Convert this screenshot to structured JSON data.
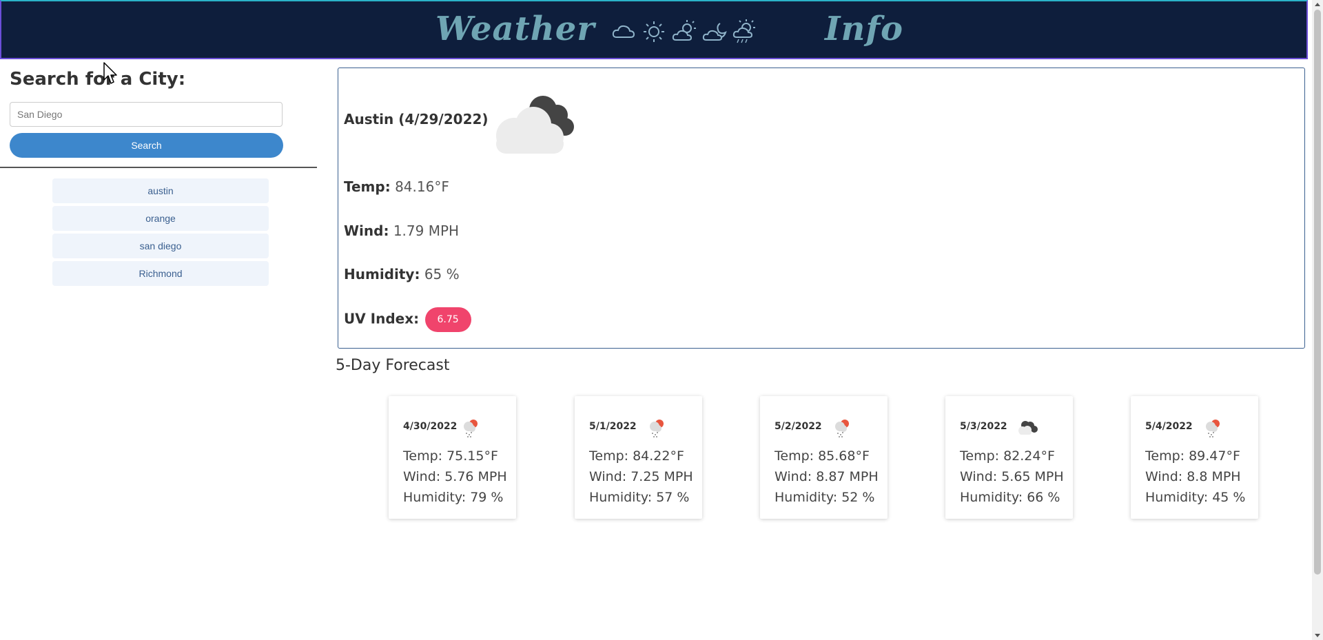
{
  "header": {
    "brand_left": "Weather",
    "brand_right": "Info",
    "icons": [
      "cloud-icon",
      "sun-icon",
      "partly-sunny-icon",
      "cloudy-night-icon",
      "sun-rain-icon"
    ],
    "brand_color": "#6fa5b3",
    "background": "#0e1e3c"
  },
  "search": {
    "title": "Search for a City:",
    "placeholder": "San Diego",
    "button_label": "Search",
    "button_color": "#3d87cc"
  },
  "history": [
    {
      "label": "austin"
    },
    {
      "label": "orange"
    },
    {
      "label": "san diego"
    },
    {
      "label": "Richmond"
    }
  ],
  "current": {
    "city_date": "Austin (4/29/2022)",
    "icon": "cloudy-overcast-icon",
    "temp_label": "Temp:",
    "temp_value": "84.16°F",
    "wind_label": "Wind:",
    "wind_value": "1.79 MPH",
    "humidity_label": "Humidity:",
    "humidity_value": "65 %",
    "uv_label": "UV Index:",
    "uv_value": "6.75",
    "uv_color": "#f0446c"
  },
  "forecast": {
    "title": "5-Day Forecast",
    "days": [
      {
        "date": "4/30/2022",
        "icon": "snow-sun-icon",
        "temp": "Temp: 75.15°F",
        "wind": "Wind: 5.76 MPH",
        "humidity": "Humidity: 79 %"
      },
      {
        "date": "5/1/2022",
        "icon": "snow-sun-icon",
        "temp": "Temp: 84.22°F",
        "wind": "Wind: 7.25 MPH",
        "humidity": "Humidity: 57 %"
      },
      {
        "date": "5/2/2022",
        "icon": "snow-sun-icon",
        "temp": "Temp: 85.68°F",
        "wind": "Wind: 8.87 MPH",
        "humidity": "Humidity: 52 %"
      },
      {
        "date": "5/3/2022",
        "icon": "dark-cloud-icon",
        "temp": "Temp: 82.24°F",
        "wind": "Wind: 5.65 MPH",
        "humidity": "Humidity: 66 %"
      },
      {
        "date": "5/4/2022",
        "icon": "snow-sun-icon",
        "temp": "Temp: 89.47°F",
        "wind": "Wind: 8.8 MPH",
        "humidity": "Humidity: 45 %"
      }
    ]
  }
}
